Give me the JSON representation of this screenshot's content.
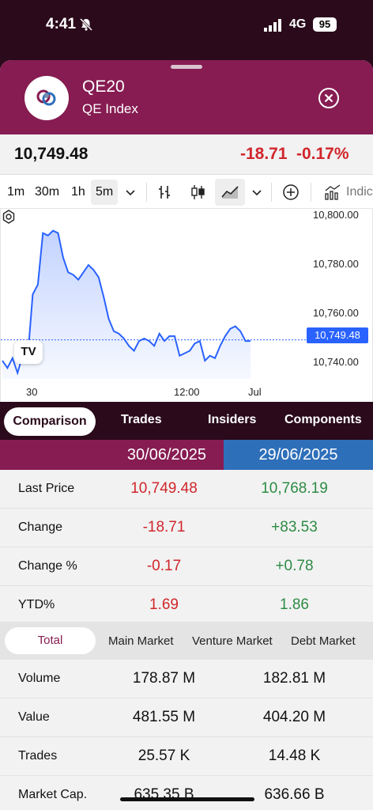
{
  "status": {
    "time": "4:41",
    "network": "4G",
    "battery": "95"
  },
  "header": {
    "code": "QE20",
    "name": "QE Index"
  },
  "quote": {
    "last": "10,749.48",
    "change": "-18.71",
    "change_pct": "-0.17%"
  },
  "toolbar": {
    "timeframes": [
      "1m",
      "30m",
      "1h",
      "5m"
    ],
    "selected_timeframe": "5m",
    "indicators_label": "Indic"
  },
  "chart_data": {
    "type": "area",
    "y_tick_labels": [
      "10,800.00",
      "10,780.00",
      "10,760.00",
      "10,740.00"
    ],
    "x_tick_labels": [
      "30",
      "12:00",
      "Jul"
    ],
    "ylim": [
      10730,
      10802
    ],
    "last_value_label": "10,749.48",
    "line_color": "#2962ff",
    "y": [
      10741,
      10738,
      10742,
      10736,
      10743,
      10742,
      10768,
      10772,
      10793,
      10792,
      10794,
      10793,
      10783,
      10777,
      10776,
      10774,
      10777,
      10780,
      10778,
      10775,
      10767,
      10758,
      10753,
      10752,
      10750,
      10747,
      10745,
      10749,
      10750,
      10749,
      10747,
      10752,
      10749,
      10751,
      10751,
      10743,
      10744,
      10745,
      10748,
      10749,
      10741,
      10743,
      10742,
      10747,
      10751,
      10754,
      10755,
      10753,
      10749,
      10749
    ]
  },
  "tabs": [
    "Comparison",
    "Trades",
    "Insiders",
    "Components"
  ],
  "compare": {
    "date_a": "30/06/2025",
    "date_b": "29/06/2025",
    "rows": [
      {
        "label": "Last Price",
        "a": "10,749.48",
        "b": "10,768.19"
      },
      {
        "label": "Change",
        "a": "-18.71",
        "b": "+83.53"
      },
      {
        "label": "Change %",
        "a": "-0.17",
        "b": "+0.78"
      },
      {
        "label": "YTD%",
        "a": "1.69",
        "b": "1.86"
      }
    ]
  },
  "market_tabs": [
    "Total",
    "Main Market",
    "Venture Market",
    "Debt Market"
  ],
  "stats": [
    {
      "label": "Volume",
      "a": "178.87 M",
      "b": "182.81 M"
    },
    {
      "label": "Value",
      "a": "481.55 M",
      "b": "404.20 M"
    },
    {
      "label": "Trades",
      "a": "25.57 K",
      "b": "14.48 K"
    },
    {
      "label": "Market Cap.",
      "a": "635.35 B",
      "b": "636.66 B"
    }
  ]
}
